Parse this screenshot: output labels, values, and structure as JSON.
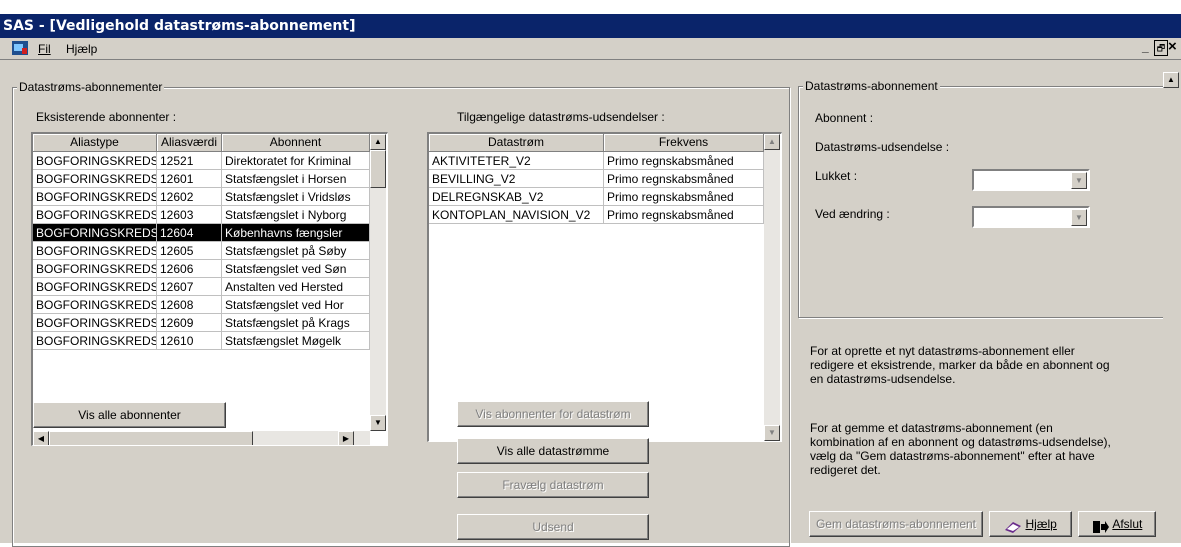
{
  "window": {
    "title": "SAS - [Vedligehold datastrøms-abonnement]",
    "min_label": "_",
    "restore_label": "🗗",
    "close_label": "×"
  },
  "menu": {
    "file": "Fil",
    "help": "Hjælp"
  },
  "subscribers": {
    "group_title": "Datastrøms-abonnementer",
    "label": "Eksisterende abonnenter :",
    "columns": [
      "Aliastype",
      "Aliasværdi",
      "Abonnent"
    ],
    "rows": [
      [
        "BOGFORINGSKREDS",
        "12521",
        "Direktoratet for Kriminal"
      ],
      [
        "BOGFORINGSKREDS",
        "12601",
        "Statsfængslet i Horsen"
      ],
      [
        "BOGFORINGSKREDS",
        "12602",
        "Statsfængslet i Vridsløs"
      ],
      [
        "BOGFORINGSKREDS",
        "12603",
        "Statsfængslet i Nyborg"
      ],
      [
        "BOGFORINGSKREDS",
        "12604",
        "Københavns fængsler"
      ],
      [
        "BOGFORINGSKREDS",
        "12605",
        "Statsfængslet på Søby"
      ],
      [
        "BOGFORINGSKREDS",
        "12606",
        "Statsfængslet ved Søn"
      ],
      [
        "BOGFORINGSKREDS",
        "12607",
        "Anstalten ved Hersted"
      ],
      [
        "BOGFORINGSKREDS",
        "12608",
        "Statsfængslet ved Hor"
      ],
      [
        "BOGFORINGSKREDS",
        "12609",
        "Statsfængslet på Krags"
      ],
      [
        "BOGFORINGSKREDS",
        "12610",
        "Statsfængslet Møgelk"
      ]
    ],
    "selected_index": 4,
    "show_all_button": "Vis alle abonnenter"
  },
  "streams": {
    "label": "Tilgængelige datastrøms-udsendelser :",
    "columns": [
      "Datastrøm",
      "Frekvens"
    ],
    "rows": [
      [
        "AKTIVITETER_V2",
        "Primo regnskabsmåned"
      ],
      [
        "BEVILLING_V2",
        "Primo regnskabsmåned"
      ],
      [
        "DELREGNSKAB_V2",
        "Primo regnskabsmåned"
      ],
      [
        "KONTOPLAN_NAVISION_V2",
        "Primo regnskabsmåned"
      ]
    ],
    "buttons": {
      "show_subscribers": "Vis abonnenter for datastrøm",
      "show_all": "Vis alle  datastrømme",
      "deselect": "Fravælg datastrøm",
      "send": "Udsend"
    }
  },
  "detail": {
    "group_title": "Datastrøms-abonnement",
    "subscriber_label": "Abonnent :",
    "broadcast_label": "Datastrøms-udsendelse :",
    "closed_label": "Lukket :",
    "closed_value": "",
    "on_change_label": "Ved ændring :",
    "on_change_value": ""
  },
  "help_text": {
    "create": "For at oprette et nyt datastrøms-abonnement eller redigere et eksistrende, marker da både en abonnent og en datastrøms-udsendelse.",
    "save": "For at gemme et datastrøms-abonnement (en kombination af en abonnent og datastrøms-udsendelse), vælg da \"Gem datastrøms-abonnement\" efter at have redigeret det."
  },
  "footer_buttons": {
    "save": "Gem datastrøms-abonnement",
    "help": "Hjælp",
    "exit": "Afslut"
  },
  "colors": {
    "title_bg": "#0a246a",
    "face": "#d4d0c8",
    "selection": "#000000"
  }
}
